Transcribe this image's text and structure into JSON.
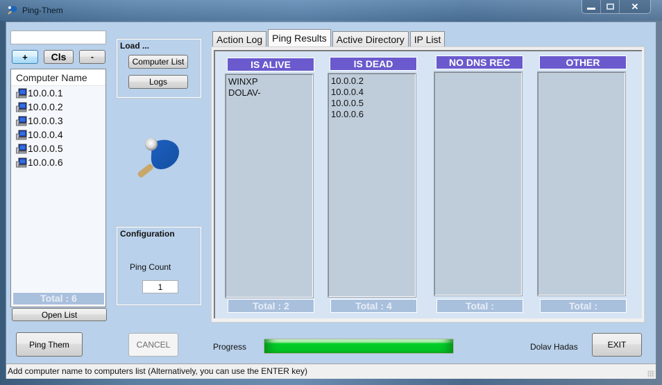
{
  "window": {
    "title": "Ping-Them",
    "controls": {
      "minimize_icon": "minimize-icon",
      "maximize_icon": "maximize-icon",
      "close_icon": "close-icon",
      "close_glyph": "✕"
    }
  },
  "left_panel": {
    "computer_input": {
      "value": "",
      "placeholder": ""
    },
    "add_button": "+",
    "clear_button": "Cls",
    "remove_button": "-",
    "list_header": "Computer Name",
    "computers": [
      "10.0.0.1",
      "10.0.0.2",
      "10.0.0.3",
      "10.0.0.4",
      "10.0.0.5",
      "10.0.0.6"
    ],
    "total": "Total : 6",
    "open_list_button": "Open List"
  },
  "load_group": {
    "title": "Load ...",
    "computer_list_button": "Computer List",
    "logs_button": "Logs"
  },
  "logo": {
    "icon": "ping-pong-paddle-icon"
  },
  "configuration": {
    "title": "Configuration",
    "ping_count_label": "Ping Count",
    "ping_count_value": "1"
  },
  "tabs": [
    {
      "label": "Action Log",
      "active": false
    },
    {
      "label": "Ping Results",
      "active": true
    },
    {
      "label": "Active Directory",
      "active": false
    },
    {
      "label": "IP List",
      "active": false
    }
  ],
  "results": {
    "header_color": "#6a5acd",
    "columns": [
      {
        "title": "IS ALIVE",
        "items": [
          "WINXP",
          "DOLAV-"
        ],
        "total": "Total : 2"
      },
      {
        "title": "IS DEAD",
        "items": [
          "10.0.0.2",
          "10.0.0.4",
          "10.0.0.5",
          "10.0.0.6"
        ],
        "total": "Total : 4"
      },
      {
        "title": "NO DNS REC",
        "items": [],
        "total": "Total :"
      },
      {
        "title": "OTHER",
        "items": [],
        "total": "Total :"
      }
    ]
  },
  "bottom": {
    "ping_button": "Ping Them",
    "cancel_button": "CANCEL",
    "progress_label": "Progress",
    "progress_percent": 100,
    "progress_color": "#00cc28",
    "author": "Dolav Hadas",
    "exit_button": "EXIT"
  },
  "status_bar": {
    "text": "Add computer name to computers list (Alternatively, you can use the ENTER key)"
  }
}
